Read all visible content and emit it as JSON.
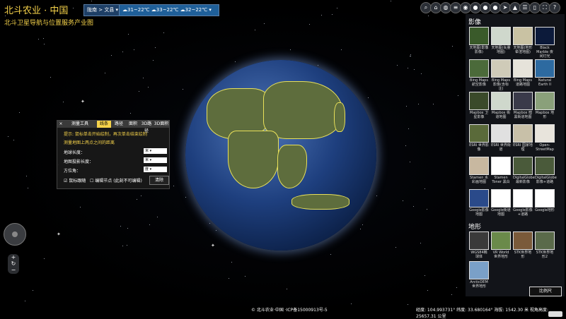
{
  "header": {
    "logo_title": "北斗农业 · 中国",
    "logo_subtitle": "北斗卫星导航与位置服务产业图",
    "location": "陇南 > 文县",
    "weather": [
      {
        "icon": "rain-cloud-icon",
        "temp": "31~22℃"
      },
      {
        "icon": "rain-cloud-icon",
        "temp": "33~22℃"
      },
      {
        "icon": "rain-cloud-icon",
        "temp": "32~22℃"
      }
    ]
  },
  "toolbar": {
    "tools": [
      {
        "name": "search-icon",
        "glyph": "⌕"
      },
      {
        "name": "home-icon",
        "glyph": "⌂"
      },
      {
        "name": "globe-grid-icon",
        "glyph": "◍"
      },
      {
        "name": "layers-icon",
        "glyph": "≡"
      },
      {
        "name": "compass-icon",
        "glyph": "◉"
      },
      {
        "name": "globe-icon",
        "glyph": "●"
      },
      {
        "name": "globe-alt-icon",
        "glyph": "●"
      },
      {
        "name": "globe-blue-icon",
        "glyph": "●"
      },
      {
        "name": "send-icon",
        "glyph": "➤"
      },
      {
        "name": "terrain-icon",
        "glyph": "▲"
      },
      {
        "name": "stack-icon",
        "glyph": "☰"
      },
      {
        "name": "mouse-icon",
        "glyph": "▯"
      },
      {
        "name": "fullscreen-icon",
        "glyph": "⛶"
      },
      {
        "name": "help-icon",
        "glyph": "?"
      }
    ]
  },
  "imagery_panel": {
    "imagery_title": "影像",
    "imagery_layers": [
      "天地图(影像影像)",
      "天地图(矢量地图)",
      "天地图(地形晕渲地图)",
      "Black Marble 夜间灯光",
      "Bing Maps 航空影像",
      "Bing Maps 影像(含标注)",
      "Bing Maps 道路地图",
      "Natural Earth II",
      "Mapbox 卫星影像",
      "Mapbox 街道地图",
      "Mapbox 暗黑街道地图",
      "Mapbox 地形",
      "ESRI 世界影像",
      "ESRI 世界街道",
      "ESRI 国家地理",
      "Open-StreetMap",
      "Stamen 水彩画地图",
      "Stamen Toner 黑白",
      "DigitalGlobe 最新影像",
      "DigitalGlobe影像+道路",
      "Google影像地图",
      "Google街道地图",
      "Google影像+道路",
      "Google地形"
    ],
    "terrain_title": "地形",
    "terrain_layers": [
      "WGS84椭球体",
      "VR World 世界地形",
      "STK世界地形",
      "STK世界地形2",
      "ArcticDEM 世界地形"
    ],
    "scale_button": "比例尺"
  },
  "measure_panel": {
    "close": "×",
    "tabs": [
      "测量工具",
      "线条",
      "路径",
      "面积",
      "3D路径",
      "3D面积"
    ],
    "hint_line1": "提示: 鼠标单击开始绘制，再次单击结束绘制",
    "hint_line2": "测量地图上两点之间的距离",
    "fields": [
      {
        "label": "地球长度：",
        "unit": "米"
      },
      {
        "label": "地图投影长度：",
        "unit": "米"
      },
      {
        "label": "方位角：",
        "unit": "度"
      }
    ],
    "checkbox1": "鼠标跟随",
    "checkbox2": "编辑节点 (此刻不可编辑)",
    "clear_button": "清除"
  },
  "footer": {
    "copyright": "北斗农业·中国 ·ICP备15000913号-5",
    "coords": "经度: 104.993731° 纬度: 33.680164° 海拔: 1542.30 米 视角高度: 25657.31 公里"
  },
  "colors": {
    "accent": "#f5d24a",
    "globe_border": "#e8e05a",
    "panel_bg": "#14161c"
  }
}
